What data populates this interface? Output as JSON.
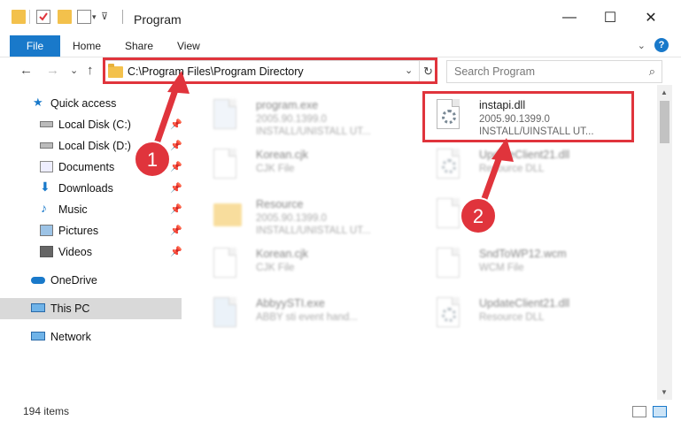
{
  "window": {
    "title": "Program",
    "minimize": "—",
    "maximize": "☐",
    "close": "✕"
  },
  "ribbon": {
    "tabs": [
      "File",
      "Home",
      "Share",
      "View"
    ],
    "help": "?"
  },
  "nav": {
    "back": "←",
    "forward": "→",
    "recent": "⌄",
    "up": "↑",
    "address": "C:\\Program Files\\Program Directory",
    "refresh": "↻",
    "search_placeholder": "Search Program"
  },
  "sidebar": {
    "items": [
      {
        "label": "Quick access",
        "icon": "star-icon"
      },
      {
        "label": "Local Disk (C:)",
        "icon": "drive-icon",
        "pinned": true
      },
      {
        "label": "Local Disk (D:)",
        "icon": "drive-icon",
        "pinned": true
      },
      {
        "label": "Documents",
        "icon": "documents-icon",
        "pinned": true
      },
      {
        "label": "Downloads",
        "icon": "download-icon",
        "pinned": true
      },
      {
        "label": "Music",
        "icon": "music-icon",
        "pinned": true
      },
      {
        "label": "Pictures",
        "icon": "pictures-icon",
        "pinned": true
      },
      {
        "label": "Videos",
        "icon": "video-icon",
        "pinned": true
      },
      {
        "label": "OneDrive",
        "icon": "cloud-icon"
      },
      {
        "label": "This PC",
        "icon": "computer-icon",
        "selected": true
      },
      {
        "label": "Network",
        "icon": "network-icon"
      }
    ]
  },
  "files": [
    {
      "name": "program.exe",
      "line1": "2005.90.1399.0",
      "line2": "INSTALL/UNISTALL UT...",
      "icon": "exe-icon",
      "blurred": true
    },
    {
      "name": "instapi.dll",
      "line1": "2005.90.1399.0",
      "line2": "INSTALL/UINSTALL UT...",
      "icon": "dll-icon",
      "blurred": false
    },
    {
      "name": "Korean.cjk",
      "line1": "CJK File",
      "line2": "",
      "icon": "file-icon",
      "blurred": true
    },
    {
      "name": "UpdateClient21.dll",
      "line1": "Resource DLL",
      "line2": "",
      "icon": "dll-icon",
      "blurred": true
    },
    {
      "name": "Resource",
      "line1": "2005.90.1399.0",
      "line2": "INSTALL/UNISTALL UT...",
      "icon": "folder-icon",
      "blurred": true
    },
    {
      "name": "...",
      "line1": "...",
      "line2": "",
      "icon": "file-icon",
      "blurred": true
    },
    {
      "name": "Korean.cjk",
      "line1": "CJK File",
      "line2": "",
      "icon": "file-icon",
      "blurred": true
    },
    {
      "name": "SndToWP12.wcm",
      "line1": "WCM File",
      "line2": "",
      "icon": "file-icon",
      "blurred": true
    },
    {
      "name": "AbbyySTI.exe",
      "line1": "ABBY sti event hand...",
      "line2": "",
      "icon": "exe-icon",
      "blurred": true
    },
    {
      "name": "UpdateClient21.dll",
      "line1": "Resource DLL",
      "line2": "",
      "icon": "dll-icon",
      "blurred": true
    }
  ],
  "status": {
    "count": "194 items"
  },
  "annotations": {
    "step1": "1",
    "step2": "2",
    "color": "#e0343c"
  }
}
